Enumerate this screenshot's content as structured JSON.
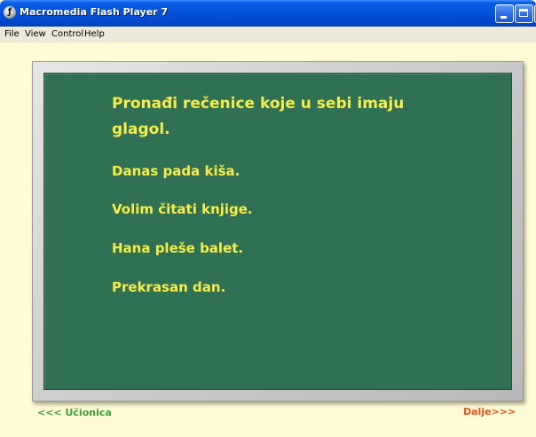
{
  "window": {
    "title": "Macromedia Flash Player 7",
    "icon": "flash-player-icon"
  },
  "menu": {
    "file": "File",
    "view": "View",
    "control": "Control",
    "help": "Help"
  },
  "board": {
    "task": "Pronađi rečenice koje u sebi imaju glagol.",
    "sentences": [
      "Danas pada kiša.",
      "Volim čitati knjige.",
      "Hana pleše balet.",
      "Prekrasan dan."
    ]
  },
  "nav": {
    "back": "<<< Učionica",
    "next": "Dalje>>>"
  },
  "colors": {
    "board": "#2f7152",
    "text": "#f7ec4a",
    "background": "#fffbd6",
    "back_link": "#3aa03a",
    "next_link": "#e8531c"
  }
}
